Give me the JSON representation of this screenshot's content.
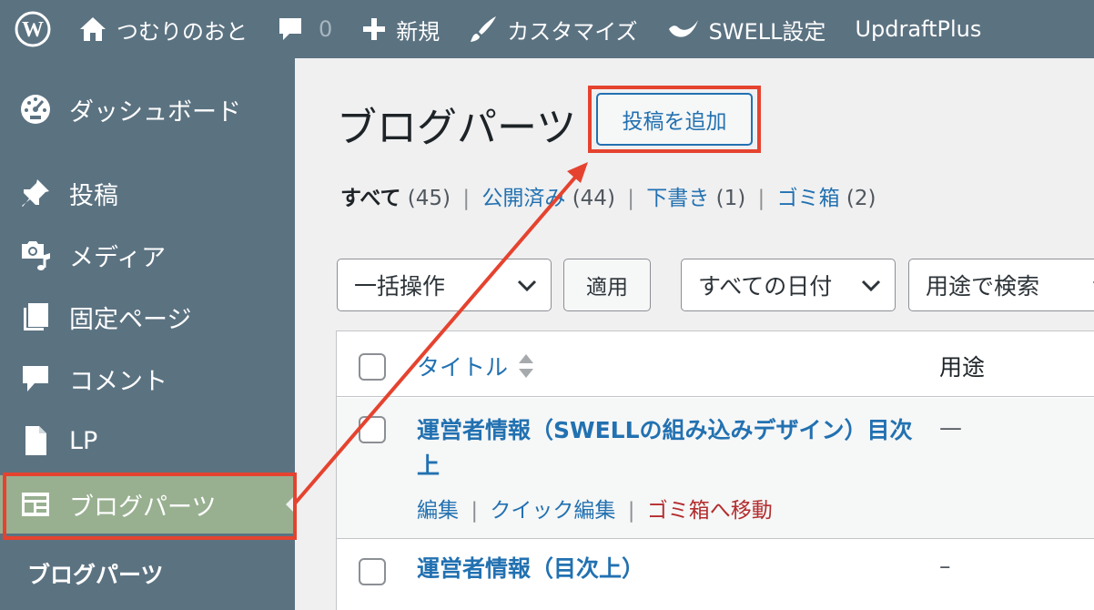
{
  "adminbar": {
    "site_name": "つむりのおと",
    "comments_count": "0",
    "new_label": "新規",
    "customize_label": "カスタマイズ",
    "swell_label": "SWELL設定",
    "updraft_label": "UpdraftPlus"
  },
  "sidebar": {
    "items": [
      {
        "label": "ダッシュボード",
        "icon": "dashboard-icon"
      },
      {
        "label": "投稿",
        "icon": "pin-icon"
      },
      {
        "label": "メディア",
        "icon": "media-icon"
      },
      {
        "label": "固定ページ",
        "icon": "pages-icon"
      },
      {
        "label": "コメント",
        "icon": "comment-icon"
      },
      {
        "label": "LP",
        "icon": "page-icon"
      },
      {
        "label": "ブログパーツ",
        "icon": "layout-icon",
        "current": true
      }
    ],
    "submenu_current": "ブログパーツ"
  },
  "page": {
    "title": "ブログパーツ",
    "add_new": "投稿を追加"
  },
  "filters": {
    "all_label": "すべて",
    "all_count": "(45)",
    "published_label": "公開済み",
    "published_count": "(44)",
    "draft_label": "下書き",
    "draft_count": "(1)",
    "trash_label": "ゴミ箱",
    "trash_count": "(2)"
  },
  "toolbar": {
    "bulk_action": "一括操作",
    "apply": "適用",
    "date_filter": "すべての日付",
    "usage_filter": "用途で検索"
  },
  "table": {
    "col_title": "タイトル",
    "col_usage": "用途",
    "rows": [
      {
        "title": "運営者情報（SWELLの組み込みデザイン）目次上",
        "usage": "—",
        "actions": {
          "edit": "編集",
          "quick_edit": "クイック編集",
          "trash": "ゴミ箱へ移動"
        }
      },
      {
        "title": "運営者情報（目次上）",
        "usage": "–"
      }
    ]
  },
  "colors": {
    "adminbar_bg": "#5b7281",
    "sidebar_current_bg": "#98b090",
    "link": "#2271b1",
    "highlight": "#e5432f",
    "trash": "#b32d2e"
  }
}
